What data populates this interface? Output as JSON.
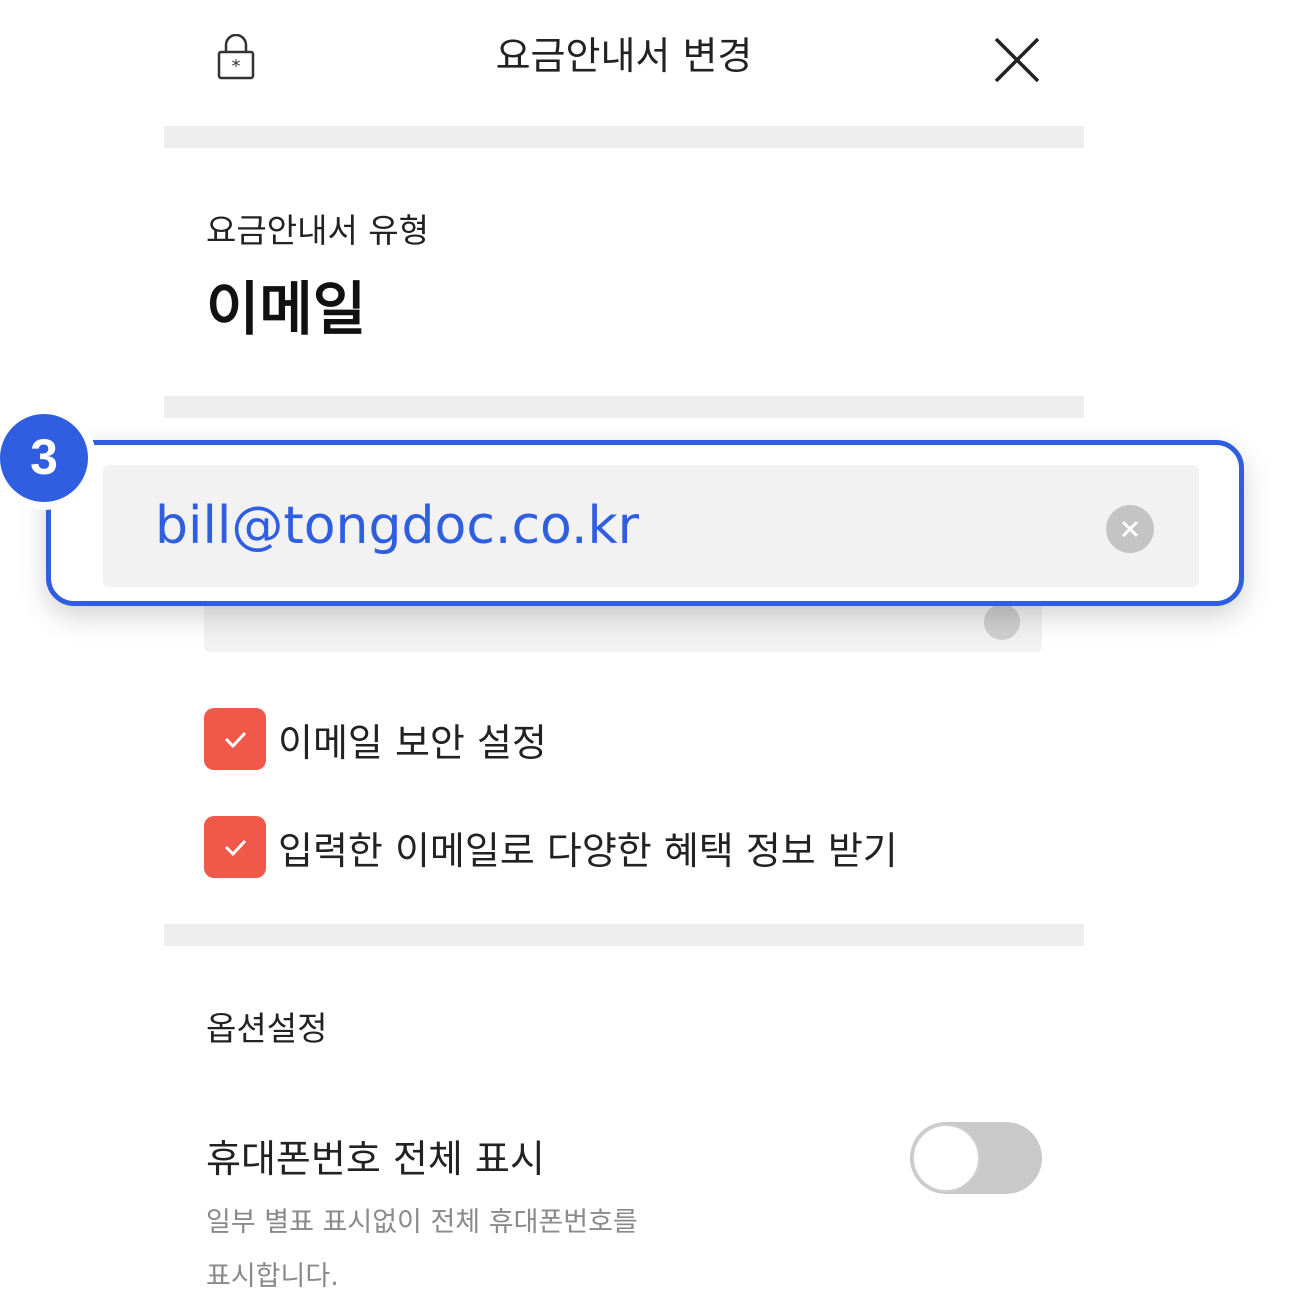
{
  "header": {
    "title": "요금안내서 변경",
    "left_icon": "lock-icon",
    "right_icon": "close-icon"
  },
  "bill_type": {
    "label": "요금안내서 유형",
    "value": "이메일"
  },
  "email": {
    "value": "bill@tongdoc.co.kr",
    "clear_icon": "clear-icon"
  },
  "callout": {
    "badge": "3",
    "color": "#2f5fe0"
  },
  "checkboxes": [
    {
      "label": "이메일 보안 설정",
      "checked": true
    },
    {
      "label": "입력한 이메일로 다양한 혜택 정보 받기",
      "checked": true
    }
  ],
  "options": {
    "section_label": "옵션설정",
    "phone_display": {
      "title": "휴대폰번호 전체 표시",
      "desc_line1": "일부 별표 표시없이 전체 휴대폰번호를",
      "desc_line2": "표시합니다.",
      "enabled": false
    }
  },
  "colors": {
    "accent_checkbox": "#f0584a",
    "highlight": "#2f5fe0"
  }
}
